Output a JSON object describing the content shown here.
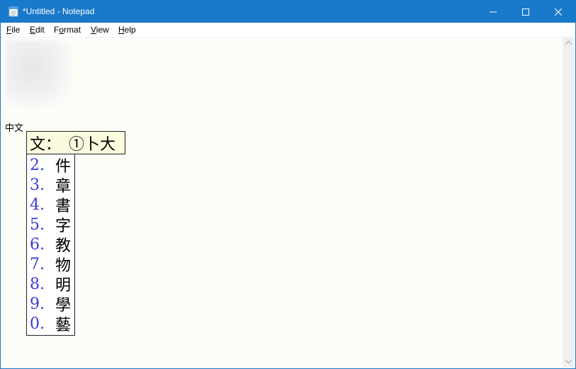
{
  "window": {
    "title": "*Untitled - Notepad"
  },
  "menu": [
    {
      "label": "File",
      "mnemonic": "F",
      "rest": "ile"
    },
    {
      "label": "Edit",
      "mnemonic": "E",
      "rest": "dit"
    },
    {
      "label": "Format",
      "mnemonic": "o",
      "prefix": "F",
      "rest": "rmat"
    },
    {
      "label": "View",
      "mnemonic": "V",
      "rest": "iew"
    },
    {
      "label": "Help",
      "mnemonic": "H",
      "rest": "elp"
    }
  ],
  "document": {
    "text": "中文"
  },
  "ime": {
    "composition": "文：　①卜大",
    "candidates": [
      {
        "num": "2.",
        "char": "件"
      },
      {
        "num": "3.",
        "char": "章"
      },
      {
        "num": "4.",
        "char": "書"
      },
      {
        "num": "5.",
        "char": "字"
      },
      {
        "num": "6.",
        "char": "教"
      },
      {
        "num": "7.",
        "char": "物"
      },
      {
        "num": "8.",
        "char": "明"
      },
      {
        "num": "9.",
        "char": "學"
      },
      {
        "num": "0.",
        "char": "藝"
      }
    ]
  },
  "colors": {
    "titlebar": "#1979ca",
    "candidate_number": "#3a3ad8",
    "composition_bg": "#fbfbe0"
  },
  "icons": [
    "notepad-icon",
    "minimize-icon",
    "maximize-icon",
    "close-icon",
    "scroll-up-icon",
    "scroll-down-icon"
  ]
}
